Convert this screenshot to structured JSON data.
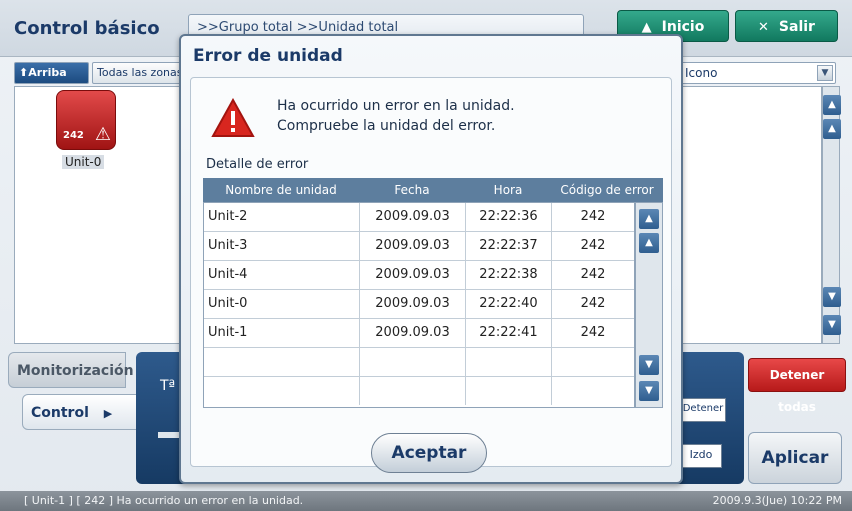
{
  "app": {
    "title": "Control básico",
    "breadcrumb": ">>Grupo total >>Unidad total",
    "inicio_label": "Inicio",
    "salir_label": "Salir",
    "arriba_label": "Arriba",
    "todas_zonas_label": "Todas las zonas",
    "view_select_value": "Icono",
    "unit": {
      "label": "Unit-0",
      "error_code": "242"
    },
    "tabs": [
      {
        "label": "Monitorización"
      },
      {
        "label": "Control"
      }
    ],
    "control": {
      "temp_label": "Tª",
      "detener_label": "Detener",
      "izdo_label": "Izdo"
    },
    "detener_todas_label": "Detener todas",
    "aplicar_label": "Aplicar",
    "status": {
      "message": "[ Unit-1 ] [ 242 ] Ha ocurrido un error en la unidad.",
      "datetime": "2009.9.3(Jue)  10:22 PM"
    }
  },
  "modal": {
    "title": "Error de unidad",
    "message_line1": "Ha ocurrido un error en la unidad.",
    "message_line2": "Compruebe la unidad del error.",
    "detail_label": "Detalle de error",
    "columns": [
      "Nombre de unidad",
      "Fecha",
      "Hora",
      "Código de error"
    ],
    "rows": [
      {
        "name": "Unit-2",
        "date": "2009.09.03",
        "time": "22:22:36",
        "code": "242"
      },
      {
        "name": "Unit-3",
        "date": "2009.09.03",
        "time": "22:22:37",
        "code": "242"
      },
      {
        "name": "Unit-4",
        "date": "2009.09.03",
        "time": "22:22:38",
        "code": "242"
      },
      {
        "name": "Unit-0",
        "date": "2009.09.03",
        "time": "22:22:40",
        "code": "242"
      },
      {
        "name": "Unit-1",
        "date": "2009.09.03",
        "time": "22:22:41",
        "code": "242"
      },
      {
        "name": "",
        "date": "",
        "time": "",
        "code": ""
      },
      {
        "name": "",
        "date": "",
        "time": "",
        "code": ""
      }
    ],
    "accept_label": "Aceptar"
  }
}
